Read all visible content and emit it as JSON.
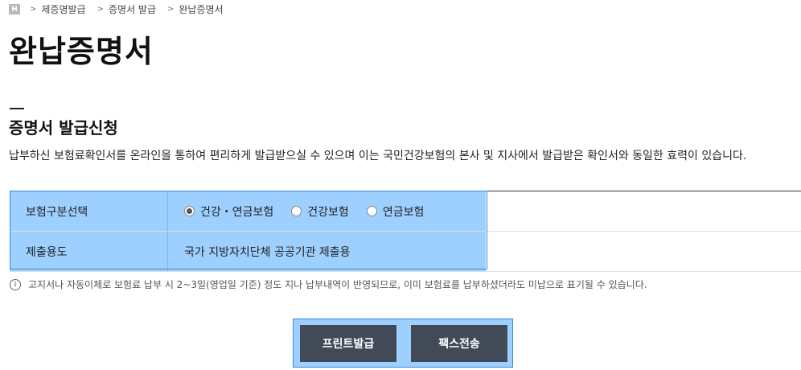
{
  "breadcrumb": {
    "home_icon": "H",
    "items": [
      "제증명발급",
      "증명서 발급",
      "완납증명서"
    ],
    "separator": ">"
  },
  "page_title": "완납증명서",
  "section_title": "증명서 발급신청",
  "description": "납부하신 보험료확인서를 온라인을 통하여 편리하게 발급받으실 수 있으며 이는 국민건강보험의 본사 및 지사에서 발급받은 확인서와 동일한 효력이 있습니다.",
  "form": {
    "insurance_type": {
      "label": "보험구분선택",
      "options": [
        {
          "label": "건강・연금보험",
          "selected": true
        },
        {
          "label": "건강보험",
          "selected": false
        },
        {
          "label": "연금보험",
          "selected": false
        }
      ]
    },
    "purpose": {
      "label": "제출용도",
      "value": "국가 지방자치단체 공공기관 제출용"
    }
  },
  "notice": {
    "icon": "info-icon",
    "text": "고지서나 자동이체로 보험료 납부 시 2~3일(영업일 기준) 정도 지나 납부내역이 반영되므로, 이미 보험료를 납부하셨더라도 미납으로 표기될 수 있습니다."
  },
  "buttons": {
    "print_label": "프린트발급",
    "fax_label": "팩스전송"
  },
  "colors": {
    "highlight": "#9dd0ff",
    "button": "#424a58"
  }
}
